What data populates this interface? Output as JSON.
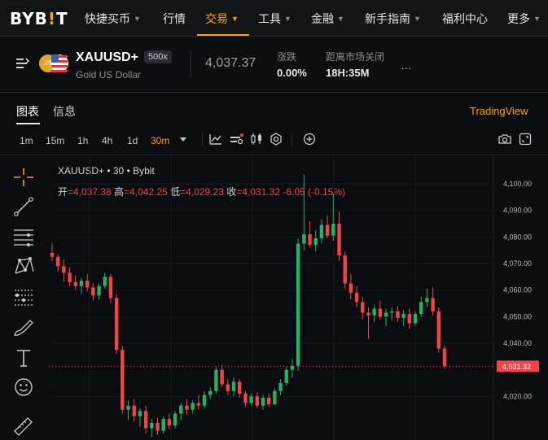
{
  "logo": {
    "text_a": "BYB",
    "bang": "!",
    "text_b": "T"
  },
  "nav": {
    "items": [
      {
        "label": "快捷买币",
        "chevron": true
      },
      {
        "label": "行情",
        "chevron": false
      },
      {
        "label": "交易",
        "chevron": true,
        "active": true
      },
      {
        "label": "工具",
        "chevron": true
      },
      {
        "label": "金融",
        "chevron": true
      },
      {
        "label": "新手指南",
        "chevron": true
      },
      {
        "label": "福利中心",
        "chevron": false
      },
      {
        "label": "更多",
        "chevron": true
      }
    ]
  },
  "ticker": {
    "symbol": "XAUUSD+",
    "leverage": "500x",
    "name": "Gold US Dollar",
    "last_price": "4,037.37",
    "change_label": "涨跌",
    "change_value": "0.00%",
    "close_label": "距离市场关闭",
    "close_value": "18H:35M",
    "more": "..."
  },
  "tabs": {
    "chart": "图表",
    "info": "信息",
    "tradingview": "TradingView"
  },
  "timeframes": [
    "1m",
    "15m",
    "1h",
    "4h",
    "1d",
    "30m"
  ],
  "active_timeframe": "30m",
  "legend": {
    "title": "XAUUSD+ • 30 • Bybit",
    "open_label": "开",
    "open": "=4,037.38",
    "high_label": "高",
    "high": "=4,042.25",
    "low_label": "低",
    "low": "=4,029.23",
    "close_label": "收",
    "close": "=4,031.32",
    "change": "-6.05 (-0.15%)"
  },
  "colors": {
    "accent": "#f7a600",
    "up": "#20b26c",
    "down": "#ef454a"
  },
  "icons": {
    "left_toolbar": [
      "crosshair-icon",
      "trend-line-icon",
      "horizontal-lines-icon",
      "pattern-icon",
      "measure-icon",
      "brush-icon",
      "text-icon",
      "emoji-icon",
      "ruler-icon"
    ],
    "top_toolbar": [
      "indicators-icon",
      "templates-icon",
      "candle-style-icon",
      "settings-icon",
      "add-icon",
      "camera-icon",
      "fullscreen-icon"
    ]
  },
  "chart_data": {
    "type": "candlestick",
    "title": "XAUUSD+ • 30 • Bybit",
    "y_ticks": [
      4100.0,
      4090.0,
      4080.0,
      4070.0,
      4060.0,
      4050.0,
      4040.0,
      4020.0
    ],
    "y_tick_labels": [
      "4,100.00",
      "4,090.00",
      "4,080.00",
      "4,070.00",
      "4,060.00",
      "4,050.00",
      "4,040.00",
      "4,020.00"
    ],
    "last_price": 4031.32,
    "last_price_label": "4,031.32",
    "candles": [
      {
        "o": 4074.0,
        "h": 4077.5,
        "l": 4071.0,
        "c": 4072.5
      },
      {
        "o": 4072.5,
        "h": 4073.5,
        "l": 4067.0,
        "c": 4069.0
      },
      {
        "o": 4069.0,
        "h": 4071.5,
        "l": 4063.0,
        "c": 4066.5
      },
      {
        "o": 4066.5,
        "h": 4068.5,
        "l": 4061.5,
        "c": 4063.0
      },
      {
        "o": 4063.0,
        "h": 4065.5,
        "l": 4060.0,
        "c": 4061.5
      },
      {
        "o": 4061.5,
        "h": 4064.5,
        "l": 4058.5,
        "c": 4063.5
      },
      {
        "o": 4063.5,
        "h": 4066.0,
        "l": 4059.5,
        "c": 4061.0
      },
      {
        "o": 4061.0,
        "h": 4062.5,
        "l": 4056.0,
        "c": 4058.0
      },
      {
        "o": 4058.0,
        "h": 4062.5,
        "l": 4056.5,
        "c": 4061.5
      },
      {
        "o": 4061.5,
        "h": 4066.5,
        "l": 4060.5,
        "c": 4065.0
      },
      {
        "o": 4065.0,
        "h": 4066.0,
        "l": 4055.0,
        "c": 4057.0
      },
      {
        "o": 4057.0,
        "h": 4058.5,
        "l": 4036.0,
        "c": 4037.5
      },
      {
        "o": 4037.5,
        "h": 4039.0,
        "l": 4013.5,
        "c": 4015.0
      },
      {
        "o": 4015.0,
        "h": 4018.5,
        "l": 4011.0,
        "c": 4016.5
      },
      {
        "o": 4016.5,
        "h": 4019.0,
        "l": 4010.5,
        "c": 4012.5
      },
      {
        "o": 4012.5,
        "h": 4015.5,
        "l": 4008.5,
        "c": 4014.5
      },
      {
        "o": 4014.5,
        "h": 4016.5,
        "l": 4006.0,
        "c": 4008.0
      },
      {
        "o": 4008.0,
        "h": 4011.5,
        "l": 4004.5,
        "c": 4010.0
      },
      {
        "o": 4010.0,
        "h": 4012.0,
        "l": 4005.5,
        "c": 4007.0
      },
      {
        "o": 4007.0,
        "h": 4012.5,
        "l": 4006.0,
        "c": 4011.5
      },
      {
        "o": 4011.5,
        "h": 4013.5,
        "l": 4007.5,
        "c": 4009.0
      },
      {
        "o": 4009.0,
        "h": 4014.5,
        "l": 4008.0,
        "c": 4013.5
      },
      {
        "o": 4013.5,
        "h": 4017.5,
        "l": 4011.0,
        "c": 4016.5
      },
      {
        "o": 4016.5,
        "h": 4019.0,
        "l": 4013.0,
        "c": 4015.0
      },
      {
        "o": 4015.0,
        "h": 4018.5,
        "l": 4013.5,
        "c": 4017.5
      },
      {
        "o": 4017.5,
        "h": 4020.5,
        "l": 4015.0,
        "c": 4016.5
      },
      {
        "o": 4016.5,
        "h": 4022.0,
        "l": 4015.5,
        "c": 4020.5
      },
      {
        "o": 4020.5,
        "h": 4023.5,
        "l": 4019.0,
        "c": 4022.0
      },
      {
        "o": 4022.0,
        "h": 4031.0,
        "l": 4021.0,
        "c": 4030.0
      },
      {
        "o": 4030.0,
        "h": 4032.0,
        "l": 4023.5,
        "c": 4024.5
      },
      {
        "o": 4024.5,
        "h": 4026.5,
        "l": 4020.5,
        "c": 4022.0
      },
      {
        "o": 4022.0,
        "h": 4027.0,
        "l": 4020.0,
        "c": 4025.5
      },
      {
        "o": 4025.5,
        "h": 4026.5,
        "l": 4019.5,
        "c": 4021.0
      },
      {
        "o": 4021.0,
        "h": 4022.0,
        "l": 4016.0,
        "c": 4017.5
      },
      {
        "o": 4017.5,
        "h": 4021.0,
        "l": 4016.5,
        "c": 4020.0
      },
      {
        "o": 4020.0,
        "h": 4021.5,
        "l": 4015.5,
        "c": 4016.5
      },
      {
        "o": 4016.5,
        "h": 4020.5,
        "l": 4015.0,
        "c": 4019.5
      },
      {
        "o": 4019.5,
        "h": 4021.0,
        "l": 4016.0,
        "c": 4017.0
      },
      {
        "o": 4017.0,
        "h": 4023.0,
        "l": 4016.5,
        "c": 4022.0
      },
      {
        "o": 4022.0,
        "h": 4026.5,
        "l": 4020.5,
        "c": 4025.0
      },
      {
        "o": 4025.0,
        "h": 4031.0,
        "l": 4024.0,
        "c": 4030.0
      },
      {
        "o": 4030.0,
        "h": 4034.0,
        "l": 4027.0,
        "c": 4031.5
      },
      {
        "o": 4031.5,
        "h": 4079.5,
        "l": 4029.5,
        "c": 4077.5
      },
      {
        "o": 4077.5,
        "h": 4103.5,
        "l": 4075.0,
        "c": 4081.0
      },
      {
        "o": 4081.0,
        "h": 4086.0,
        "l": 4076.0,
        "c": 4077.0
      },
      {
        "o": 4077.0,
        "h": 4082.5,
        "l": 4074.5,
        "c": 4079.5
      },
      {
        "o": 4079.5,
        "h": 4086.5,
        "l": 4077.5,
        "c": 4084.5
      },
      {
        "o": 4084.5,
        "h": 4088.0,
        "l": 4079.5,
        "c": 4080.5
      },
      {
        "o": 4080.5,
        "h": 4096.5,
        "l": 4078.5,
        "c": 4085.0
      },
      {
        "o": 4085.0,
        "h": 4089.5,
        "l": 4071.0,
        "c": 4073.0
      },
      {
        "o": 4073.0,
        "h": 4074.5,
        "l": 4060.5,
        "c": 4062.5
      },
      {
        "o": 4062.5,
        "h": 4066.0,
        "l": 4056.5,
        "c": 4059.0
      },
      {
        "o": 4059.0,
        "h": 4061.5,
        "l": 4053.5,
        "c": 4055.5
      },
      {
        "o": 4055.5,
        "h": 4057.5,
        "l": 4049.0,
        "c": 4051.5
      },
      {
        "o": 4051.5,
        "h": 4053.5,
        "l": 4041.5,
        "c": 4050.5
      },
      {
        "o": 4050.5,
        "h": 4054.5,
        "l": 4048.0,
        "c": 4053.0
      },
      {
        "o": 4053.0,
        "h": 4056.0,
        "l": 4049.0,
        "c": 4050.0
      },
      {
        "o": 4050.0,
        "h": 4053.0,
        "l": 4046.5,
        "c": 4051.5
      },
      {
        "o": 4051.5,
        "h": 4053.5,
        "l": 4048.5,
        "c": 4052.0
      },
      {
        "o": 4052.0,
        "h": 4054.0,
        "l": 4048.0,
        "c": 4049.5
      },
      {
        "o": 4049.5,
        "h": 4052.5,
        "l": 4046.5,
        "c": 4051.0
      },
      {
        "o": 4051.0,
        "h": 4053.0,
        "l": 4045.5,
        "c": 4047.5
      },
      {
        "o": 4047.5,
        "h": 4052.0,
        "l": 4046.5,
        "c": 4051.0
      },
      {
        "o": 4051.0,
        "h": 4057.5,
        "l": 4050.0,
        "c": 4055.5
      },
      {
        "o": 4055.5,
        "h": 4060.5,
        "l": 4053.5,
        "c": 4057.0
      },
      {
        "o": 4057.0,
        "h": 4061.0,
        "l": 4050.5,
        "c": 4052.0
      },
      {
        "o": 4052.0,
        "h": 4053.5,
        "l": 4036.5,
        "c": 4038.0
      },
      {
        "o": 4038.0,
        "h": 4039.0,
        "l": 4030.5,
        "c": 4031.3
      }
    ]
  }
}
